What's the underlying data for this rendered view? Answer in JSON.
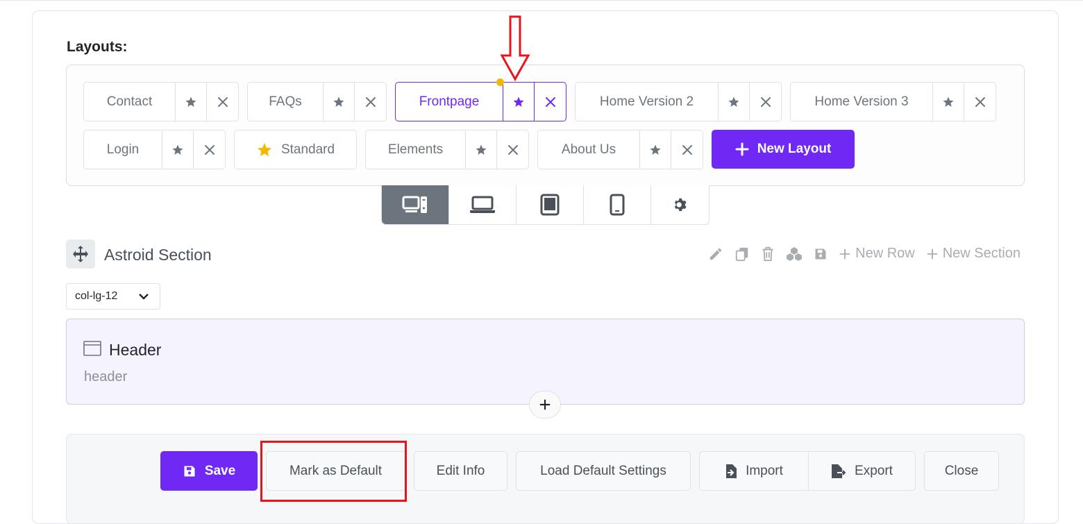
{
  "layouts_title": "Layouts:",
  "layouts": [
    {
      "name": "Contact",
      "active": false,
      "default": false
    },
    {
      "name": "FAQs",
      "active": false,
      "default": false
    },
    {
      "name": "Frontpage",
      "active": true,
      "default": false
    },
    {
      "name": "Home Version 2",
      "active": false,
      "default": false
    },
    {
      "name": "Home Version 3",
      "active": false,
      "default": false
    },
    {
      "name": "Login",
      "active": false,
      "default": false
    },
    {
      "name": "Standard",
      "active": false,
      "default": true
    },
    {
      "name": "Elements",
      "active": false,
      "default": false
    },
    {
      "name": "About Us",
      "active": false,
      "default": false
    }
  ],
  "new_layout_label": "New Layout",
  "devices": [
    "desktop-icon",
    "laptop-icon",
    "tablet-icon",
    "mobile-icon",
    "gear-icon"
  ],
  "section": {
    "title": "Astroid Section",
    "new_row": "New Row",
    "new_section": "New Section",
    "col_select": "col-lg-12"
  },
  "element": {
    "title": "Header",
    "subtitle": "header"
  },
  "footer": {
    "save": "Save",
    "mark_default": "Mark as Default",
    "edit_info": "Edit Info",
    "load_default": "Load Default Settings",
    "import": "Import",
    "export": "Export",
    "close": "Close"
  },
  "colors": {
    "accent": "#7028f5",
    "star_default": "#f5b800",
    "annotation": "#e8141c"
  }
}
